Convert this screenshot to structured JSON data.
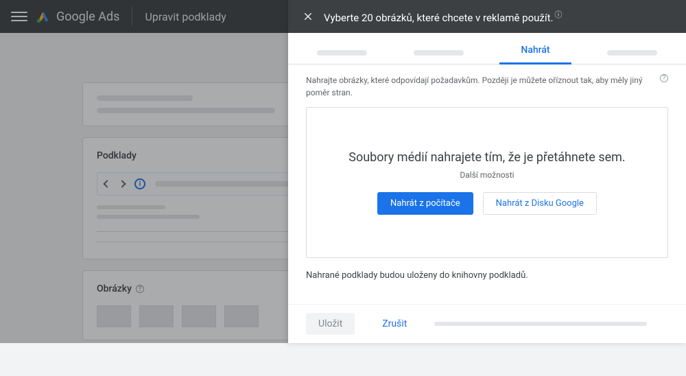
{
  "header": {
    "brand": "Google Ads",
    "section": "Upravit podklady"
  },
  "underlay": {
    "card_title": "Podklady",
    "images_title": "Obrázky"
  },
  "panel": {
    "title": "Vyberte 20 obrázků, které chcete v reklamě použít.",
    "tabs": {
      "active_label": "Nahrát"
    },
    "hint": "Nahrajte obrázky, které odpovídají požadavkům. Později je můžete oříznout tak, aby měly jiný poměr stran.",
    "dropzone": {
      "title": "Soubory médií nahrajete tím, že je přetáhnete sem.",
      "subtitle": "Další možnosti",
      "btn_upload": "Nahrát z počítače",
      "btn_drive": "Nahrát z Disku Google"
    },
    "note": "Nahrané podklady budou uloženy do knihovny podkladů.",
    "footer": {
      "save": "Uložit",
      "cancel": "Zrušit"
    }
  }
}
